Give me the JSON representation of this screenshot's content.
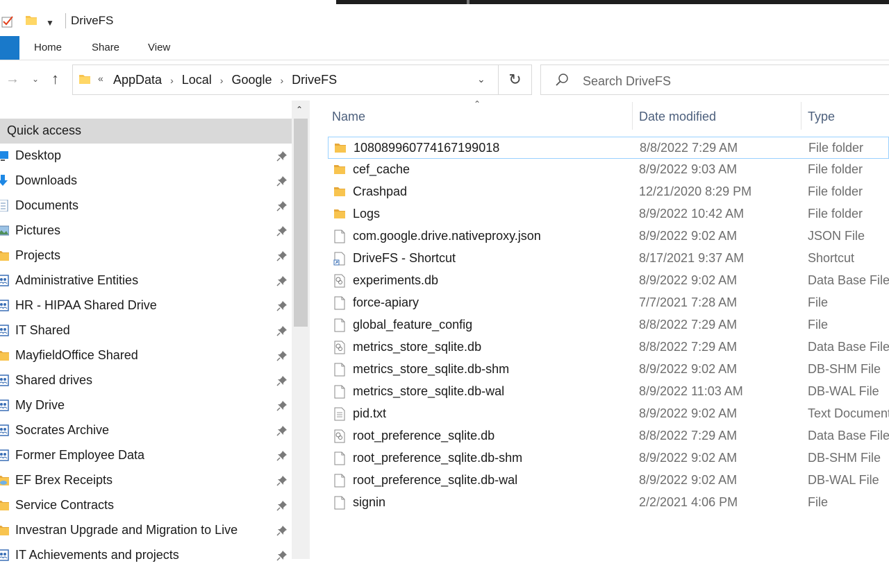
{
  "window": {
    "title": "DriveFS"
  },
  "ribbon": {
    "tabs": [
      "Home",
      "Share",
      "View"
    ]
  },
  "address": {
    "crumbs": [
      "AppData",
      "Local",
      "Google",
      "DriveFS"
    ]
  },
  "search": {
    "placeholder": "Search DriveFS"
  },
  "nav": {
    "quick_access": "Quick access",
    "items": [
      {
        "label": "Desktop",
        "icon": "desktop-icon"
      },
      {
        "label": "Downloads",
        "icon": "downloads-icon"
      },
      {
        "label": "Documents",
        "icon": "documents-icon"
      },
      {
        "label": "Pictures",
        "icon": "pictures-icon"
      },
      {
        "label": "Projects",
        "icon": "folder-icon"
      },
      {
        "label": "Administrative Entities",
        "icon": "shared-folder-icon"
      },
      {
        "label": "HR - HIPAA Shared Drive",
        "icon": "shared-folder-icon"
      },
      {
        "label": "IT Shared",
        "icon": "shared-folder-icon"
      },
      {
        "label": "MayfieldOffice Shared",
        "icon": "folder-icon"
      },
      {
        "label": "Shared drives",
        "icon": "shared-folder-icon"
      },
      {
        "label": "My Drive",
        "icon": "shared-folder-icon"
      },
      {
        "label": "Socrates Archive",
        "icon": "shared-folder-icon"
      },
      {
        "label": "Former Employee Data",
        "icon": "shared-folder-icon"
      },
      {
        "label": "EF Brex Receipts",
        "icon": "cloud-folder-icon"
      },
      {
        "label": "Service Contracts",
        "icon": "folder-icon"
      },
      {
        "label": "Investran Upgrade and Migration to Live",
        "icon": "folder-icon"
      },
      {
        "label": "IT Achievements and projects",
        "icon": "shared-folder-icon"
      }
    ]
  },
  "columns": {
    "name": "Name",
    "date": "Date modified",
    "type": "Type"
  },
  "files": [
    {
      "name": "10808996077416719901​8",
      "date": "8/8/2022 7:29 AM",
      "type": "File folder",
      "icon": "folder-icon"
    },
    {
      "name": "cef_cache",
      "date": "8/9/2022 9:03 AM",
      "type": "File folder",
      "icon": "folder-icon"
    },
    {
      "name": "Crashpad",
      "date": "12/21/2020 8:29 PM",
      "type": "File folder",
      "icon": "folder-icon"
    },
    {
      "name": "Logs",
      "date": "8/9/2022 10:42 AM",
      "type": "File folder",
      "icon": "folder-icon"
    },
    {
      "name": "com.google.drive.nativeproxy.json",
      "date": "8/9/2022 9:02 AM",
      "type": "JSON File",
      "icon": "file-icon"
    },
    {
      "name": "DriveFS - Shortcut",
      "date": "8/17/2021 9:37 AM",
      "type": "Shortcut",
      "icon": "shortcut-icon"
    },
    {
      "name": "experiments.db",
      "date": "8/9/2022 9:02 AM",
      "type": "Data Base File",
      "icon": "db-file-icon"
    },
    {
      "name": "force-apiary",
      "date": "7/7/2021 7:28 AM",
      "type": "File",
      "icon": "file-icon"
    },
    {
      "name": "global_feature_config",
      "date": "8/8/2022 7:29 AM",
      "type": "File",
      "icon": "file-icon"
    },
    {
      "name": "metrics_store_sqlite.db",
      "date": "8/8/2022 7:29 AM",
      "type": "Data Base File",
      "icon": "db-file-icon"
    },
    {
      "name": "metrics_store_sqlite.db-shm",
      "date": "8/9/2022 9:02 AM",
      "type": "DB-SHM File",
      "icon": "file-icon"
    },
    {
      "name": "metrics_store_sqlite.db-wal",
      "date": "8/9/2022 11:03 AM",
      "type": "DB-WAL File",
      "icon": "file-icon"
    },
    {
      "name": "pid.txt",
      "date": "8/9/2022 9:02 AM",
      "type": "Text Document",
      "icon": "text-file-icon"
    },
    {
      "name": "root_preference_sqlite.db",
      "date": "8/8/2022 7:29 AM",
      "type": "Data Base File",
      "icon": "db-file-icon"
    },
    {
      "name": "root_preference_sqlite.db-shm",
      "date": "8/9/2022 9:02 AM",
      "type": "DB-SHM File",
      "icon": "file-icon"
    },
    {
      "name": "root_preference_sqlite.db-wal",
      "date": "8/9/2022 9:02 AM",
      "type": "DB-WAL File",
      "icon": "file-icon"
    },
    {
      "name": "signin",
      "date": "2/2/2021 4:06 PM",
      "type": "File",
      "icon": "file-icon"
    }
  ],
  "colors": {
    "accent": "#1979ca",
    "folder": "#f8c44f",
    "selection_border": "#99d1ff"
  }
}
